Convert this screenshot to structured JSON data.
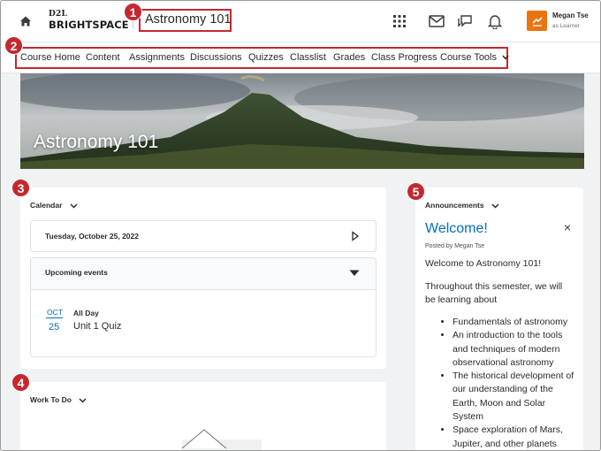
{
  "header": {
    "logo_top": "D2L",
    "logo_bottom": "BRIGHTSPACE",
    "course_title": "Astronomy 101",
    "user_name": "Megan Tse",
    "user_role": "as Learner",
    "icons": [
      "home-icon",
      "waffle-grid-icon",
      "mail-icon",
      "chat-icon",
      "bell-icon"
    ]
  },
  "callouts": [
    "1",
    "2",
    "3",
    "4",
    "5"
  ],
  "nav": {
    "items": [
      "Course Home",
      "Content",
      "Assignments",
      "Discussions",
      "Quizzes",
      "Classlist",
      "Grades",
      "Class Progress",
      "Course Tools"
    ]
  },
  "banner": {
    "title": "Astronomy 101"
  },
  "calendar": {
    "heading": "Calendar",
    "date": "Tuesday, October 25, 2022",
    "upcoming_heading": "Upcoming events",
    "events": [
      {
        "month": "OCT",
        "day": "25",
        "time": "All Day",
        "name": "Unit 1 Quiz"
      }
    ]
  },
  "todo": {
    "heading": "Work To Do"
  },
  "announcements": {
    "heading": "Announcements",
    "title": "Welcome!",
    "posted_by": "Posted by Megan Tse",
    "greeting": "Welcome to Astronomy 101!",
    "intro_line1": "Throughout this semester, we will",
    "intro_line2": "be learning about",
    "bullets": [
      "Fundamentals of astronomy",
      "An introduction to the tools and techniques of modern observational astronomy",
      "The historical development of our understanding of the Earth, Moon and Solar System",
      "Space exploration of Mars, Jupiter, and other planets"
    ]
  },
  "colors": {
    "accent": "#006fbf",
    "callout": "#c4282f",
    "avatar": "#e87511"
  }
}
